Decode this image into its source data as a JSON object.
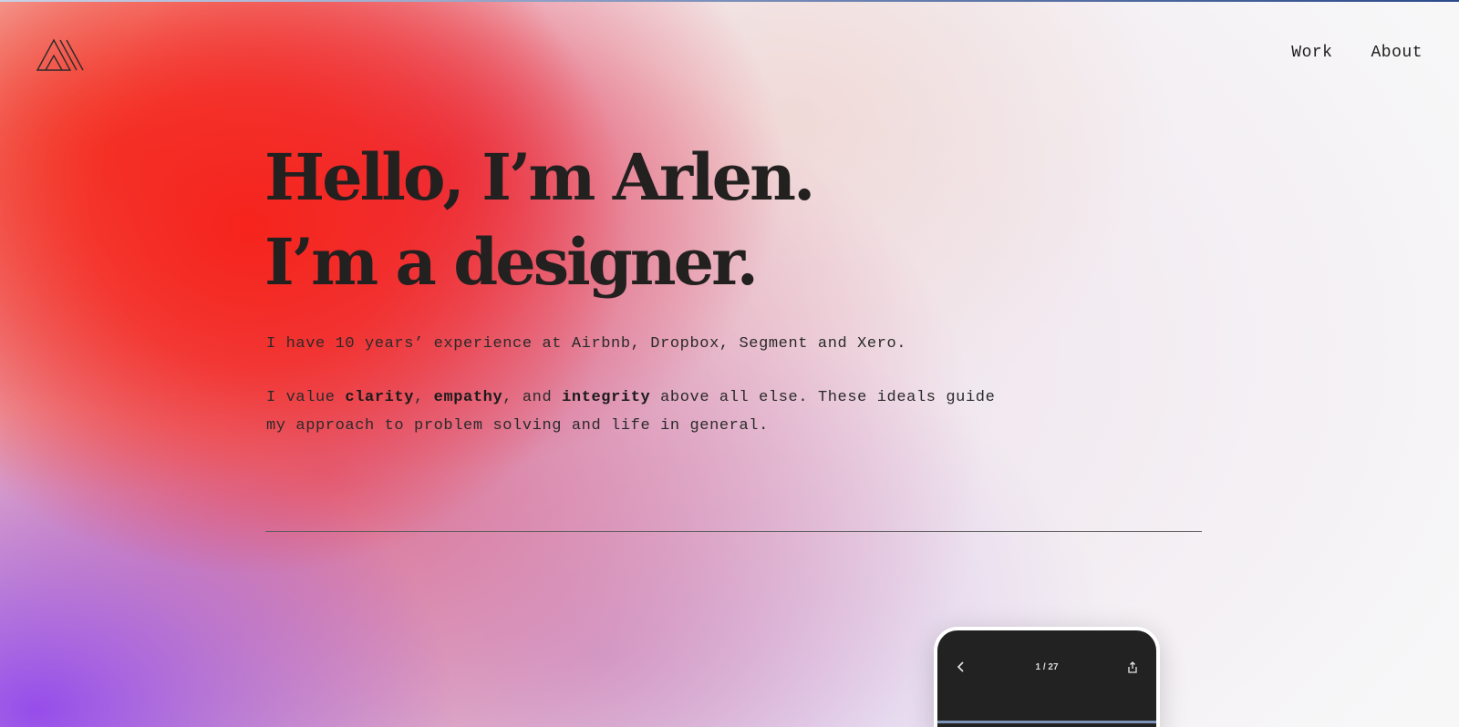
{
  "header": {
    "logo_icon": "triangle-stripes-logo-icon",
    "nav": [
      {
        "label": "Work"
      },
      {
        "label": "About"
      }
    ]
  },
  "hero": {
    "line1": "Hello, I’m Arlen.",
    "line2": "I’m a designer."
  },
  "intro": {
    "experience": "I have 10 years’ experience at Airbnb, Dropbox, Segment and Xero.",
    "values_prefix": "I value ",
    "value1": "clarity",
    "sep1": ", ",
    "value2": "empathy",
    "sep2": ", and ",
    "value3": "integrity",
    "values_suffix": " above all else. These ideals guide my approach to problem solving and life in general."
  },
  "phone_preview": {
    "counter": "1 / 27",
    "back_icon": "chevron-left-icon",
    "share_icon": "share-icon"
  },
  "colors": {
    "text": "#232020",
    "gradient_red": "#f6221a",
    "gradient_purple": "#9146eb",
    "phone_screen": "#222222"
  }
}
